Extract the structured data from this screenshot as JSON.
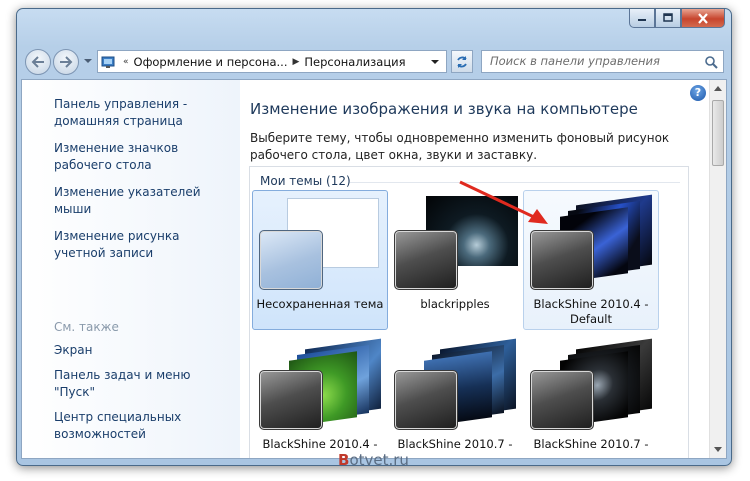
{
  "nav": {
    "address_segments": [
      "Оформление и персона...",
      "Персонализация"
    ],
    "search_placeholder": "Поиск в панели управления"
  },
  "sidebar": {
    "links": [
      {
        "label": "Панель управления - домашняя страница"
      },
      {
        "label": "Изменение значков рабочего стола"
      },
      {
        "label": "Изменение указателей мыши"
      },
      {
        "label": "Изменение рисунка учетной записи"
      }
    ],
    "see_also_title": "См. также",
    "see_also": [
      {
        "label": "Экран"
      },
      {
        "label": "Панель задач и меню \"Пуск\""
      },
      {
        "label": "Центр специальных возможностей"
      }
    ]
  },
  "main": {
    "title": "Изменение изображения и звука на компьютере",
    "description": "Выберите тему, чтобы одновременно изменить фоновый рисунок рабочего стола, цвет окна, звуки и заставку.",
    "group_title": "Мои темы (12)",
    "themes": [
      {
        "name": "Несохраненная тема",
        "state": "selected"
      },
      {
        "name": "blackripples",
        "state": "normal"
      },
      {
        "name": "BlackShine 2010.4 - Default",
        "state": "hover"
      },
      {
        "name": "BlackShine 2010.4 -",
        "state": "normal"
      },
      {
        "name": "BlackShine 2010.7 -",
        "state": "normal"
      },
      {
        "name": "BlackShine 2010.7 -",
        "state": "normal"
      }
    ]
  },
  "watermark": {
    "first": "B",
    "rest": "otvet.ru"
  },
  "colors": {
    "link": "#1a3e6b",
    "title": "#1e395b",
    "annotation_arrow": "#e02a1f"
  }
}
